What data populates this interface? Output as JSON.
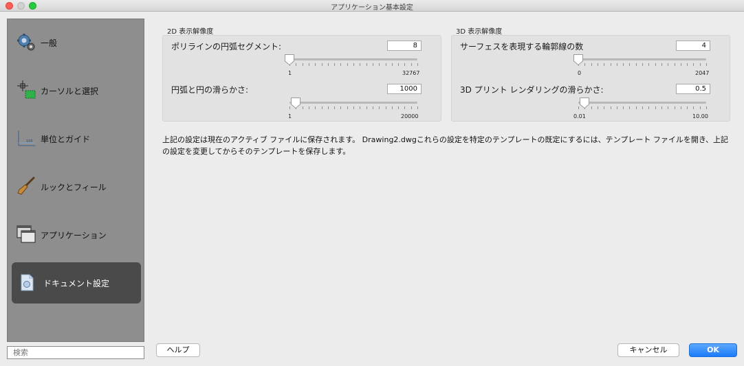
{
  "window": {
    "title": "アプリケーション基本設定"
  },
  "sidebar": {
    "items": [
      {
        "label": "一般",
        "icon": "gears-icon"
      },
      {
        "label": "カーソルと選択",
        "icon": "cursor-select-icon"
      },
      {
        "label": "単位とガイド",
        "icon": "units-guide-icon"
      },
      {
        "label": "ルックとフィール",
        "icon": "brush-icon"
      },
      {
        "label": "アプリケーション",
        "icon": "windows-icon"
      },
      {
        "label": "ドキュメント設定",
        "icon": "document-icon"
      }
    ],
    "selected": "ドキュメント設定",
    "search_placeholder": "検索"
  },
  "display_2d": {
    "title": "2D 表示解像度",
    "polyline": {
      "label": "ポリラインの円弧セグメント:",
      "value": "8",
      "min_label": "1",
      "max_label": "32767",
      "fraction": 0.0
    },
    "circle": {
      "label": "円弧と円の滑らかさ:",
      "value": "1000",
      "min_label": "1",
      "max_label": "20000",
      "fraction": 0.05
    }
  },
  "display_3d": {
    "title": "3D 表示解像度",
    "contour": {
      "label": "サーフェスを表現する輪郭線の数",
      "value": "4",
      "min_label": "0",
      "max_label": "2047",
      "fraction": 0.0
    },
    "print3d": {
      "label": "3D プリント レンダリングの滑らかさ:",
      "value": "0.5",
      "min_label": "0.01",
      "max_label": "10.00",
      "fraction": 0.05
    }
  },
  "note": "上記の設定は現在のアクティブ ファイルに保存されます。 Drawing2.dwgこれらの設定を特定のテンプレートの既定にするには、テンプレート ファイルを開き、上記の設定を変更してからそのテンプレートを保存します。",
  "buttons": {
    "help": "ヘルプ",
    "cancel": "キャンセル",
    "ok": "OK"
  },
  "colors": {
    "accent": "#1a7bf7",
    "sidebar": "#8e8e8e",
    "selected": "#4a4a4a"
  }
}
